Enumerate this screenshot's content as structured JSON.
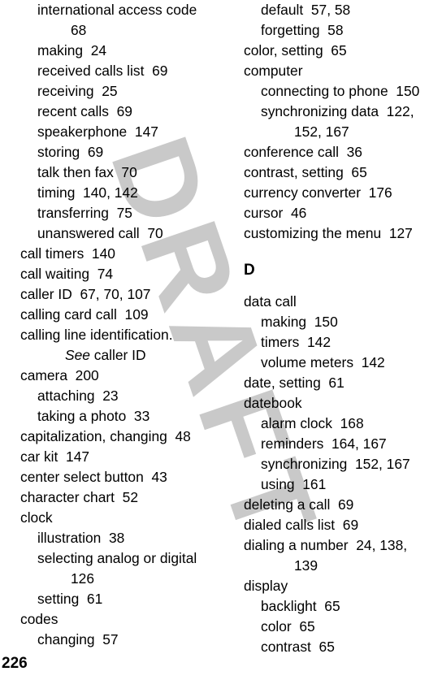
{
  "page": {
    "folio": "226",
    "watermark": "DRAFT",
    "watermark_color": "#c9c9c9"
  },
  "left_column": {
    "entries": [
      {
        "level": 1,
        "text": "international access code"
      },
      {
        "level": "cont",
        "text": "68"
      },
      {
        "level": 1,
        "text": "making  24"
      },
      {
        "level": 1,
        "text": "received calls list  69"
      },
      {
        "level": 1,
        "text": "receiving  25"
      },
      {
        "level": 1,
        "text": "recent calls  69"
      },
      {
        "level": 1,
        "text": "speakerphone  147"
      },
      {
        "level": 1,
        "text": "storing  69"
      },
      {
        "level": 1,
        "text": "talk then fax  70"
      },
      {
        "level": 1,
        "text": "timing  140, 142"
      },
      {
        "level": 1,
        "text": "transferring  75"
      },
      {
        "level": 1,
        "text": "unanswered call  70"
      },
      {
        "level": 0,
        "text": "call timers  140"
      },
      {
        "level": 0,
        "text": "call waiting  74"
      },
      {
        "level": 0,
        "text": "caller ID  67, 70, 107"
      },
      {
        "level": 0,
        "text": "calling card call  109"
      },
      {
        "level": 0,
        "text": "calling line identification."
      },
      {
        "level": "cont-see",
        "see": "See",
        "text": " caller ID"
      },
      {
        "level": 0,
        "text": "camera  200"
      },
      {
        "level": 1,
        "text": "attaching  23"
      },
      {
        "level": 1,
        "text": "taking a photo  33"
      },
      {
        "level": 0,
        "text": "capitalization, changing  48"
      },
      {
        "level": 0,
        "text": "car kit  147"
      },
      {
        "level": 0,
        "text": "center select button  43"
      },
      {
        "level": 0,
        "text": "character chart  52"
      },
      {
        "level": 0,
        "text": "clock"
      },
      {
        "level": 1,
        "text": "illustration  38"
      },
      {
        "level": 1,
        "text": "selecting analog or digital"
      },
      {
        "level": "cont",
        "text": "126"
      },
      {
        "level": 1,
        "text": "setting  61"
      },
      {
        "level": 0,
        "text": "codes"
      },
      {
        "level": 1,
        "text": "changing  57"
      }
    ]
  },
  "right_column": {
    "entries": [
      {
        "level": 1,
        "text": "default  57, 58"
      },
      {
        "level": 1,
        "text": "forgetting  58"
      },
      {
        "level": 0,
        "text": "color, setting  65"
      },
      {
        "level": 0,
        "text": "computer"
      },
      {
        "level": 1,
        "text": "connecting to phone  150"
      },
      {
        "level": 1,
        "text": "synchronizing data  122,"
      },
      {
        "level": "cont",
        "text": "152, 167"
      },
      {
        "level": 0,
        "text": "conference call  36"
      },
      {
        "level": 0,
        "text": "contrast, setting  65"
      },
      {
        "level": 0,
        "text": "currency converter  176"
      },
      {
        "level": 0,
        "text": "cursor  46"
      },
      {
        "level": 0,
        "text": "customizing the menu  127"
      },
      {
        "level": "heading",
        "text": "D"
      },
      {
        "level": 0,
        "text": "data call"
      },
      {
        "level": 1,
        "text": "making  150"
      },
      {
        "level": 1,
        "text": "timers  142"
      },
      {
        "level": 1,
        "text": "volume meters  142"
      },
      {
        "level": 0,
        "text": "date, setting  61"
      },
      {
        "level": 0,
        "text": "datebook"
      },
      {
        "level": 1,
        "text": "alarm clock  168"
      },
      {
        "level": 1,
        "text": "reminders  164, 167"
      },
      {
        "level": 1,
        "text": "synchronizing  152, 167"
      },
      {
        "level": 1,
        "text": "using  161"
      },
      {
        "level": 0,
        "text": "deleting a call  69"
      },
      {
        "level": 0,
        "text": "dialed calls list  69"
      },
      {
        "level": 0,
        "text": "dialing a number  24, 138,"
      },
      {
        "level": "cont",
        "text": "139"
      },
      {
        "level": 0,
        "text": "display"
      },
      {
        "level": 1,
        "text": "backlight  65"
      },
      {
        "level": 1,
        "text": "color  65"
      },
      {
        "level": 1,
        "text": "contrast  65"
      }
    ]
  }
}
